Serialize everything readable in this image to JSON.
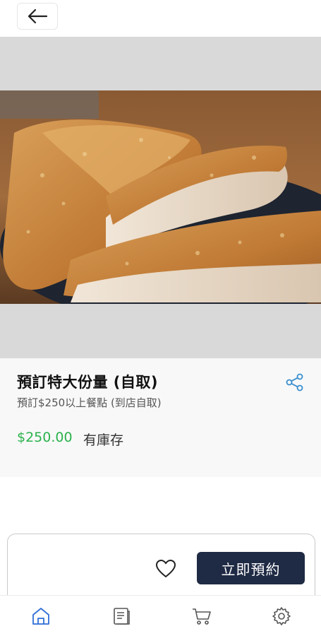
{
  "header": {
    "back_icon": "arrow-left-icon"
  },
  "product": {
    "image_alt": "fried chicken cutlet",
    "title": "預訂特大份量 (自取)",
    "subtitle": "預訂$250以上餐點 (到店自取)",
    "price": "$250.00",
    "stock_status": "有庫存",
    "share_icon": "share-icon",
    "price_color": "#2bb24c"
  },
  "actions": {
    "favorite_icon": "heart-icon",
    "reserve_label": "立即預約",
    "button_color": "#1f2a44"
  },
  "nav": {
    "items": [
      {
        "icon": "home-icon",
        "active": true,
        "color": "#2f6fd6"
      },
      {
        "icon": "menu-book-icon",
        "active": false
      },
      {
        "icon": "cart-icon",
        "active": false
      },
      {
        "icon": "settings-icon",
        "active": false
      }
    ]
  }
}
